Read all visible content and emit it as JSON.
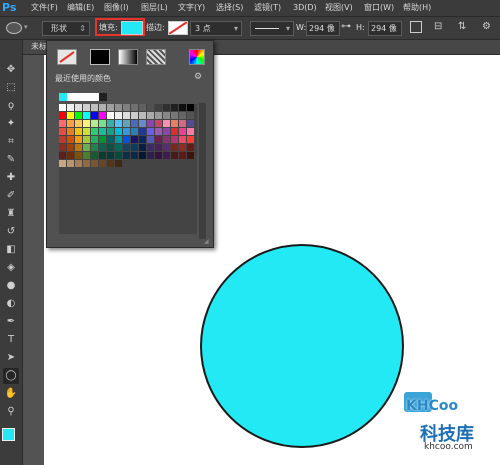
{
  "app": {
    "logo": "Ps"
  },
  "menu": [
    "文件(F)",
    "编辑(E)",
    "图像(I)",
    "图层(L)",
    "文字(Y)",
    "选择(S)",
    "滤镜(T)",
    "3D(D)",
    "视图(V)",
    "窗口(W)",
    "帮助(H)"
  ],
  "options": {
    "shape_mode": "形状",
    "fill_label": "填充:",
    "fill_color": "#22e9f3",
    "stroke_label": "描边:",
    "stroke_width": "3 点",
    "w_label": "W:",
    "w_value": "294 像",
    "h_label": "H:",
    "h_value": "294 像"
  },
  "document": {
    "tab_label": "未标"
  },
  "fill_panel": {
    "recent_label": "最近使用的颜色",
    "recent_colors": [
      "#22e9f3",
      "#ffffff",
      "#ffffff",
      "#ffffff",
      "#ffffff",
      "#222222"
    ],
    "grayscale_row": [
      "#ffffff",
      "#f0f0f0",
      "#e0e0e0",
      "#d0d0d0",
      "#c0c0c0",
      "#b0b0b0",
      "#a0a0a0",
      "#909090",
      "#808080",
      "#707070",
      "#606060",
      "#505050",
      "#404040",
      "#303030",
      "#202020",
      "#101010",
      "#000000"
    ],
    "swatch_rows": [
      [
        "#ff0000",
        "#ffff00",
        "#00ff00",
        "#00ffff",
        "#0000ff",
        "#ff00ff",
        "#ffffff",
        "#eeeeee",
        "#dddddd",
        "#cccccc",
        "#bbbbbb",
        "#aaaaaa",
        "#999999",
        "#888888",
        "#777777",
        "#666666",
        "#555555"
      ],
      [
        "#ff6b6b",
        "#ff9f43",
        "#feca57",
        "#fff176",
        "#b8e994",
        "#78e08f",
        "#38ada9",
        "#4fc3f7",
        "#60a3bc",
        "#4a69bd",
        "#6a89cc",
        "#8e44ad",
        "#c44569",
        "#f78fb3",
        "#e77f67",
        "#cf6a87",
        "#574b90"
      ],
      [
        "#e74c3c",
        "#e67e22",
        "#f1c40f",
        "#c4e538",
        "#2ecc71",
        "#1abc9c",
        "#16a085",
        "#00bcd4",
        "#3498db",
        "#2980b9",
        "#1e3799",
        "#6c5ce7",
        "#9b59b6",
        "#8e44ad",
        "#d63031",
        "#e84393",
        "#fd79a8"
      ],
      [
        "#c0392b",
        "#d35400",
        "#f39c12",
        "#a3cb38",
        "#27ae60",
        "#009432",
        "#006266",
        "#0097a7",
        "#0652dd",
        "#1b1464",
        "#0c2461",
        "#5758bb",
        "#6f1e51",
        "#833471",
        "#b33771",
        "#ed4c67",
        "#ff3f34"
      ],
      [
        "#8e2d24",
        "#a04000",
        "#b9770e",
        "#6ab04c",
        "#1e8449",
        "#0e6251",
        "#0b5345",
        "#00695c",
        "#154360",
        "#0a3d62",
        "#0a1f44",
        "#3c2a6b",
        "#4a235a",
        "#5b2c6f",
        "#78281f",
        "#922b21",
        "#641e16"
      ],
      [
        "#5d1f1a",
        "#6e2c00",
        "#7e5109",
        "#4b7f2a",
        "#145a32",
        "#0b3d2e",
        "#073b3a",
        "#004d40",
        "#0d2f4a",
        "#0a2a4a",
        "#071633",
        "#2c1f4f",
        "#34143f",
        "#3e1c4f",
        "#4a1a14",
        "#5e1a14",
        "#3d1410"
      ],
      [
        "#c8a882",
        "#b8956a",
        "#a57e55",
        "#8f6a42",
        "#7a5733",
        "#664626",
        "#53361b",
        "#402812"
      ]
    ]
  },
  "watermark": {
    "logo_text": "KHCoo",
    "brand": "科技库",
    "url": "khcoo.com"
  }
}
